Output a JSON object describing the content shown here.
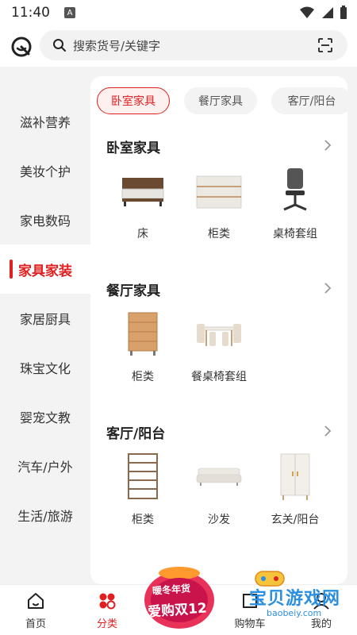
{
  "status_bar": {
    "time": "11:40",
    "app_icon": "A"
  },
  "search": {
    "placeholder": "搜索货号/关键字"
  },
  "sidebar": {
    "items": [
      {
        "label": "滋补营养"
      },
      {
        "label": "美妆个护"
      },
      {
        "label": "家电数码"
      },
      {
        "label": "家具家装",
        "active": true
      },
      {
        "label": "家居厨具"
      },
      {
        "label": "珠宝文化"
      },
      {
        "label": "婴宠文教"
      },
      {
        "label": "汽车/户外"
      },
      {
        "label": "生活/旅游"
      }
    ]
  },
  "chips": [
    {
      "label": "卧室家具",
      "active": true
    },
    {
      "label": "餐厅家具"
    },
    {
      "label": "客厅/阳台"
    }
  ],
  "sections": [
    {
      "title": "卧室家具",
      "products": [
        {
          "name": "床"
        },
        {
          "name": "柜类"
        },
        {
          "name": "桌椅套组"
        }
      ]
    },
    {
      "title": "餐厅家具",
      "products": [
        {
          "name": "柜类"
        },
        {
          "name": "餐桌椅套组"
        }
      ]
    },
    {
      "title": "客厅/阳台",
      "products": [
        {
          "name": "柜类"
        },
        {
          "name": "沙发"
        },
        {
          "name": "玄关/阳台"
        }
      ]
    }
  ],
  "bottom_nav": {
    "items": [
      {
        "label": "首页"
      },
      {
        "label": "分类",
        "active": true
      },
      {
        "label": "购物车"
      },
      {
        "label": "我的"
      }
    ]
  },
  "promo": {
    "line1": "暖冬年货",
    "line2": "爱购双12"
  },
  "watermark": {
    "text": "宝贝游戏网",
    "url": "baobeiy.com"
  },
  "colors": {
    "accent": "#e02020",
    "background": "#f3f3f3"
  }
}
